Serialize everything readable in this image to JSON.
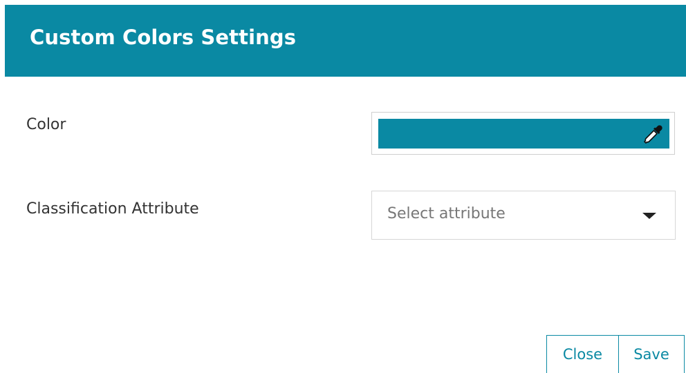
{
  "dialog": {
    "title": "Custom Colors Settings",
    "header_color": "#0a89a3"
  },
  "color_field": {
    "label": "Color",
    "value": "#0a89a3",
    "icon": "eyedropper-icon"
  },
  "attribute_field": {
    "label": "Classification Attribute",
    "placeholder": "Select attribute",
    "icon": "chevron-down-icon"
  },
  "footer": {
    "close_label": "Close",
    "save_label": "Save"
  }
}
